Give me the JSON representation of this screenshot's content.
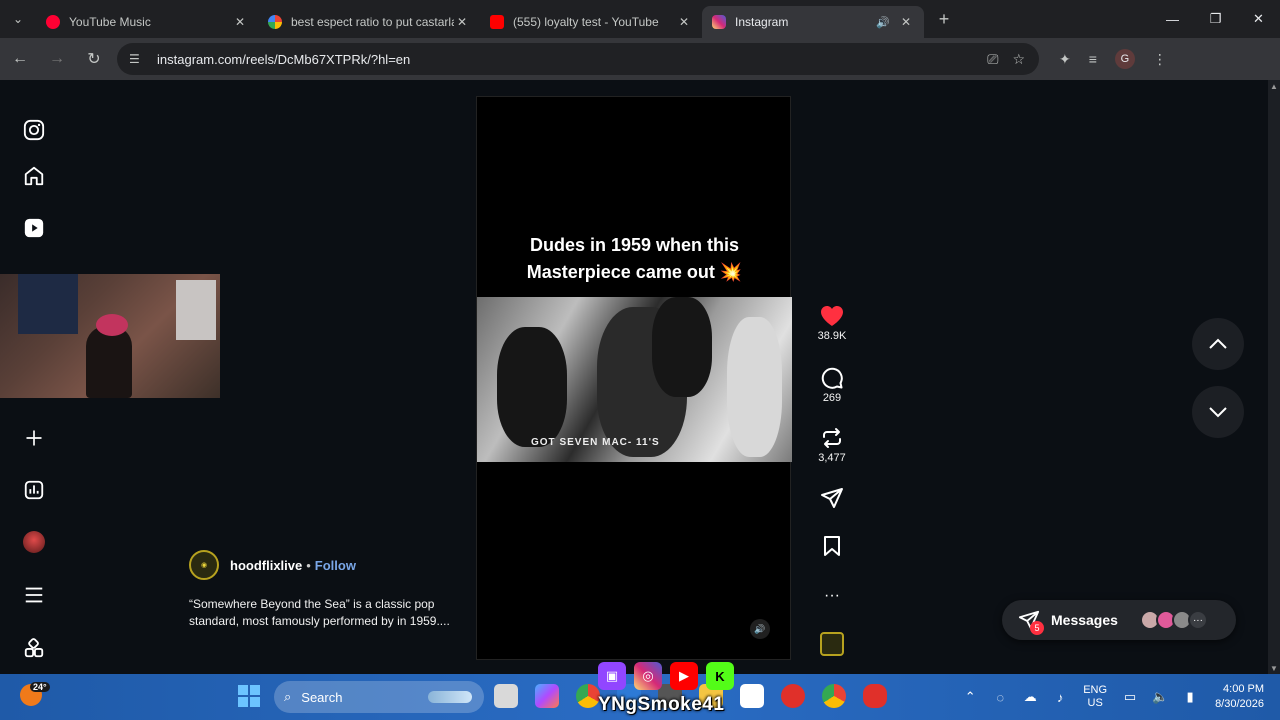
{
  "browser": {
    "tabs": [
      {
        "title": "YouTube Music",
        "favicon_color": "#ff0033",
        "active": false
      },
      {
        "title": "best espect ratio to put castarla",
        "favicon_color": "#4285f4",
        "active": false
      },
      {
        "title": "(555) loyalty test - YouTube",
        "favicon_color": "#ff0000",
        "active": false
      },
      {
        "title": "Instagram",
        "favicon_color": "#d6249f",
        "active": true
      }
    ],
    "url": "instagram.com/reels/DcMb67XTPRk/?hl=en",
    "profile_initial": "G"
  },
  "reel": {
    "caption_line1": "Dudes in 1959 when this",
    "caption_line2": "Masterpiece came out 💥",
    "image_text": "GOT  SEVEN   MAC- 11'S"
  },
  "author": {
    "handle": "hoodflixlive",
    "separator": "•",
    "follow_label": "Follow",
    "description": "“Somewhere Beyond the Sea” is a classic pop standard, most famously performed by in 1959...."
  },
  "actions": {
    "likes": "38.9K",
    "comments": "269",
    "reposts": "3,477"
  },
  "messages": {
    "label": "Messages",
    "badge": "5",
    "more": "···"
  },
  "taskbar": {
    "weather_temp": "24°",
    "search_label": "Search",
    "streamer_name": "YNgSmoke41",
    "lang_line1": "ENG",
    "lang_line2": "US",
    "time": "4:00 PM",
    "date": "8/30/2026"
  },
  "colors": {
    "like": "#ff3040",
    "follow": "#7aa7e8",
    "taskbar": "#2462b8"
  }
}
